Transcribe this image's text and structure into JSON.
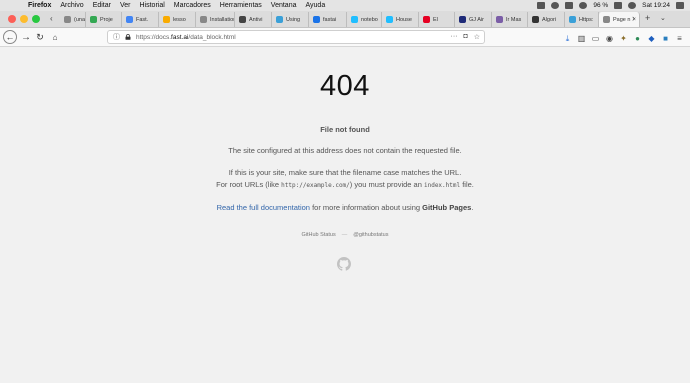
{
  "menubar": {
    "apple": "",
    "app_name": "Firefox",
    "items": [
      "Archivo",
      "Editar",
      "Ver",
      "Historial",
      "Marcadores",
      "Herramientas",
      "Ventana",
      "Ayuda"
    ],
    "battery": "96 %",
    "clock": "Sat 19:24"
  },
  "tabs": [
    {
      "label": "(una",
      "color": "#888888"
    },
    {
      "label": "Proje",
      "color": "#34a853"
    },
    {
      "label": "Fast.",
      "color": "#4285f4"
    },
    {
      "label": "lesso",
      "color": "#f9ab00"
    },
    {
      "label": "Installation",
      "color": "#888888"
    },
    {
      "label": "Antivi",
      "color": "#444444"
    },
    {
      "label": "Using",
      "color": "#3aa0d8"
    },
    {
      "label": "fastai",
      "color": "#1a73e8"
    },
    {
      "label": "notebo",
      "color": "#20beff"
    },
    {
      "label": "House",
      "color": "#20beff"
    },
    {
      "label": "El",
      "color": "#e60023"
    },
    {
      "label": "GJ Air",
      "color": "#1e2a78"
    },
    {
      "label": "Ir Mas",
      "color": "#7b5ea7"
    },
    {
      "label": "Algori",
      "color": "#333333"
    },
    {
      "label": "Https:",
      "color": "#3aa0d8"
    },
    {
      "label": "Page n",
      "color": "#888888"
    }
  ],
  "nav": {
    "url_prefix": "https://docs.",
    "url_domain": "fast.ai",
    "url_path": "/data_block.html"
  },
  "content": {
    "code": "404",
    "subtitle": "File not found",
    "para1": "The site configured at this address does not contain the requested file.",
    "para2_line1": "If this is your site, make sure that the filename case matches the URL.",
    "para2_line2_a": "For root URLs (like ",
    "para2_line2_code1": "http://example.com/",
    "para2_line2_b": ") you must provide an ",
    "para2_line2_code2": "index.html",
    "para2_line2_c": " file.",
    "para3_link": "Read the full documentation",
    "para3_mid": " for more information about using ",
    "para3_bold": "GitHub Pages",
    "para3_end": "."
  },
  "footer": {
    "status": "GitHub Status",
    "separator": "—",
    "handle": "@githubstatus"
  }
}
